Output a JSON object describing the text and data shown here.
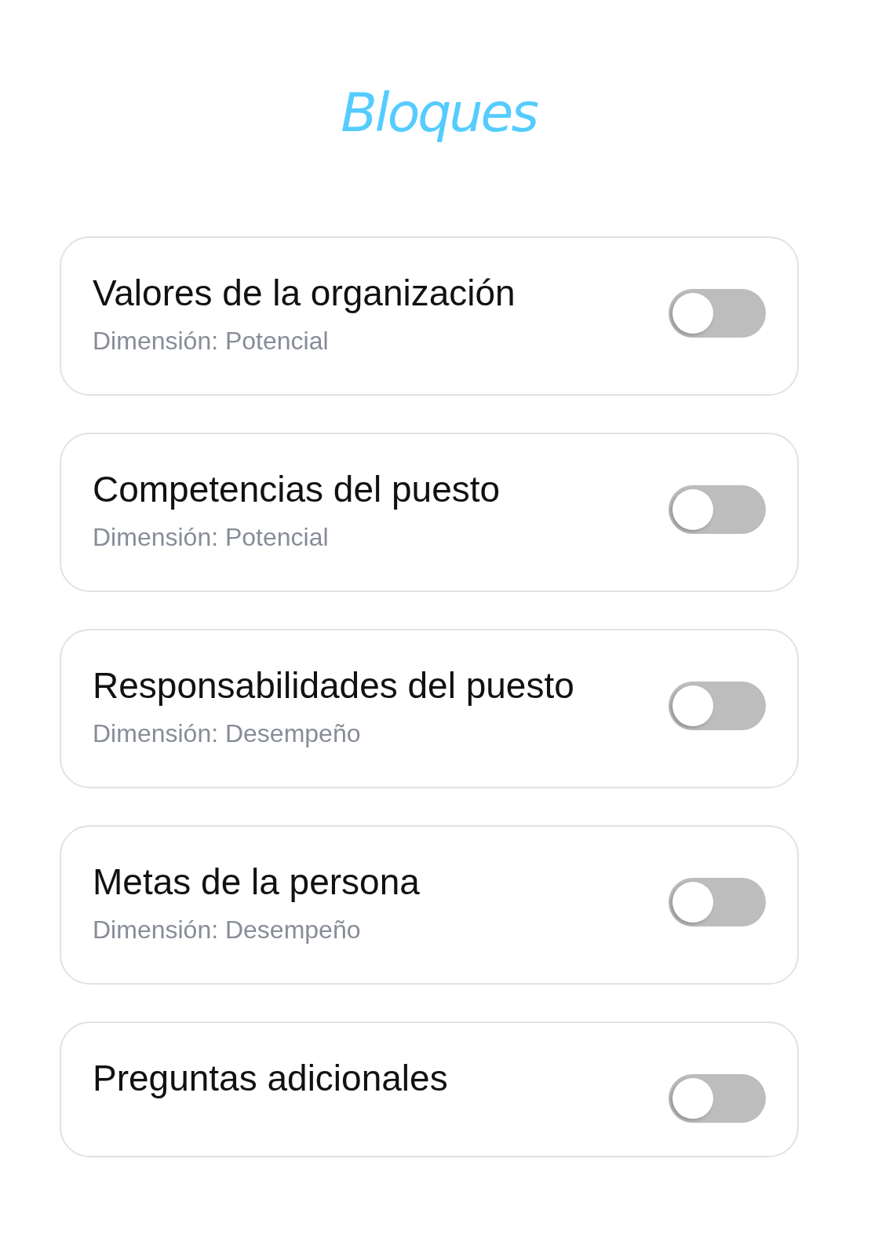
{
  "title": "Bloques",
  "blocks": [
    {
      "name": "Valores de la organización",
      "dimension": "Dimensión: Potencial",
      "on": false
    },
    {
      "name": "Competencias del puesto",
      "dimension": "Dimensión: Potencial",
      "on": false
    },
    {
      "name": "Responsabilidades del puesto",
      "dimension": "Dimensión: Desempeño",
      "on": false
    },
    {
      "name": "Metas de la persona",
      "dimension": "Dimensión: Desempeño",
      "on": false
    },
    {
      "name": "Preguntas adicionales",
      "on": false
    }
  ]
}
